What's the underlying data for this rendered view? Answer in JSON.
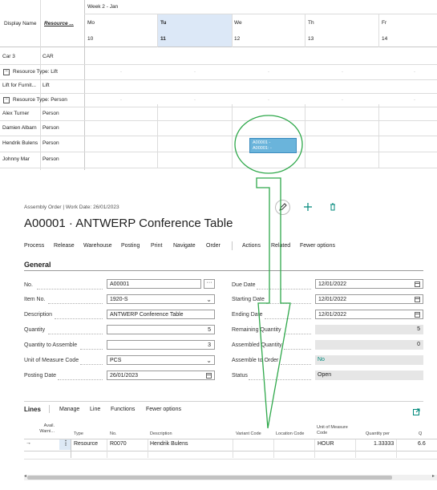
{
  "scheduler": {
    "col_display_name": "Display Name",
    "col_resource": "Resource ...",
    "week_label": "Week 2 - Jan",
    "days": [
      {
        "name": "Mo",
        "num": "10"
      },
      {
        "name": "Tu",
        "num": "11"
      },
      {
        "name": "We",
        "num": "12"
      },
      {
        "name": "Th",
        "num": "13"
      },
      {
        "name": "Fr",
        "num": "14"
      }
    ],
    "rows": [
      {
        "name": "Car 3",
        "res": "CAR"
      },
      {
        "name": "Resource Type: Lift",
        "res": ""
      },
      {
        "name": "Lift for Furnit...",
        "res": "Lift"
      },
      {
        "name": "Resource Type: Person",
        "res": ""
      },
      {
        "name": "Alex Turner",
        "res": "Person"
      },
      {
        "name": "Damien Albarn",
        "res": "Person"
      },
      {
        "name": "Hendrik Bulens",
        "res": "Person"
      },
      {
        "name": "Johnny Mar",
        "res": "Person"
      }
    ],
    "booking_line1": "A00001 -",
    "booking_line2": "A00001: -"
  },
  "card": {
    "breadcrumb": "Assembly Order | Work Date: 26/01/2023",
    "title": "A00001 · ANTWERP Conference Table",
    "actions": [
      "Process",
      "Release",
      "Warehouse",
      "Posting",
      "Print",
      "Navigate",
      "Order",
      "Actions",
      "Related",
      "Fewer options"
    ],
    "section_general": "General",
    "left_fields": [
      {
        "label": "No.",
        "value": "A00001"
      },
      {
        "label": "Item No.",
        "value": "1920-S"
      },
      {
        "label": "Description",
        "value": "ANTWERP Conference Table"
      },
      {
        "label": "Quantity",
        "value": "5"
      },
      {
        "label": "Quantity to Assemble",
        "value": "3"
      },
      {
        "label": "Unit of Measure Code",
        "value": "PCS"
      },
      {
        "label": "Posting Date",
        "value": "26/01/2023"
      }
    ],
    "right_fields": [
      {
        "label": "Due Date",
        "value": "12/01/2022"
      },
      {
        "label": "Starting Date",
        "value": "12/01/2022"
      },
      {
        "label": "Ending Date",
        "value": "12/01/2022"
      },
      {
        "label": "Remaining Quantity",
        "value": "5"
      },
      {
        "label": "Assembled Quantity",
        "value": "0"
      },
      {
        "label": "Assemble to Order",
        "value": "No"
      },
      {
        "label": "Status",
        "value": "Open"
      }
    ],
    "lines": {
      "title": "Lines",
      "actions": [
        "Manage",
        "Line",
        "Functions",
        "Fewer options"
      ],
      "headers": {
        "avail": "Avail. Warni...",
        "type": "Type",
        "no": "No.",
        "description": "Description",
        "variant": "Variant Code",
        "location": "Location Code",
        "uom": "Unit of Measure Code",
        "qty_per": "Quantity per",
        "q": "Q"
      },
      "row": {
        "arrow": "→",
        "type": "Resource",
        "no": "R0070",
        "description": "Hendrik Bulens",
        "uom": "HOUR",
        "qty_per": "1.33333",
        "q": "6.6"
      }
    }
  },
  "colors": {
    "accent_green": "#2ea84a",
    "booking_blue": "#6ab4db",
    "selected_day": "#dce8f7",
    "link_teal": "#00897b"
  }
}
